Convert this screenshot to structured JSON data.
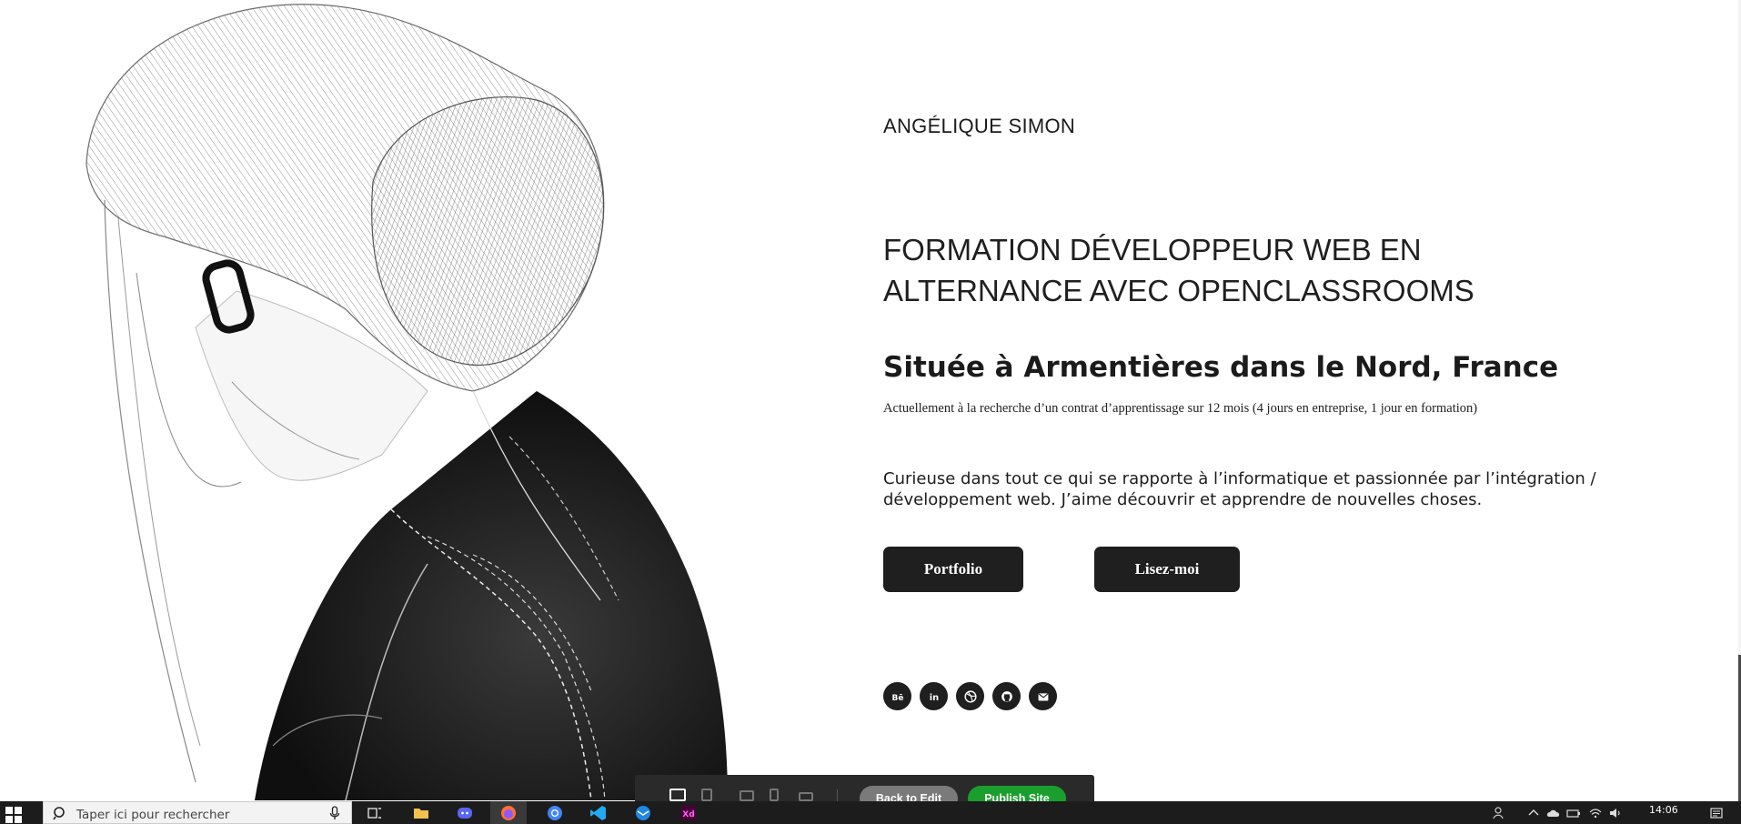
{
  "profile": {
    "name": "ANGÉLIQUE SIMON",
    "headline": "FORMATION DÉVELOPPEUR WEB EN ALTERNANCE AVEC OPENCLASSROOMS",
    "location": "Située à Armentières dans le Nord, France",
    "search": "Actuellement à la recherche d’un contrat d’apprentissage sur 12 mois (4 jours en entreprise, 1 jour en formation)",
    "bio": "Curieuse dans tout ce qui se rapporte à l’informatique et passionnée par l’intégration / développement web. J’aime découvrir et apprendre de nouvelles choses."
  },
  "buttons": {
    "portfolio": "Portfolio",
    "readme": "Lisez-moi"
  },
  "socials": [
    {
      "icon": "behance-icon",
      "label": "Bē"
    },
    {
      "icon": "linkedin-icon",
      "label": "in"
    },
    {
      "icon": "dribbble-icon",
      "label": ""
    },
    {
      "icon": "github-icon",
      "label": ""
    },
    {
      "icon": "email-icon",
      "label": ""
    }
  ],
  "editor": {
    "back": "Back to Edit",
    "publish": "Publish Site"
  },
  "taskbar": {
    "search_placeholder": "Taper ici pour rechercher",
    "time": "14:06"
  },
  "colors": {
    "text": "#1b1b1b",
    "button": "#1f1f1f",
    "publish": "#1a9f2e",
    "taskbar": "#1c1c1c"
  }
}
